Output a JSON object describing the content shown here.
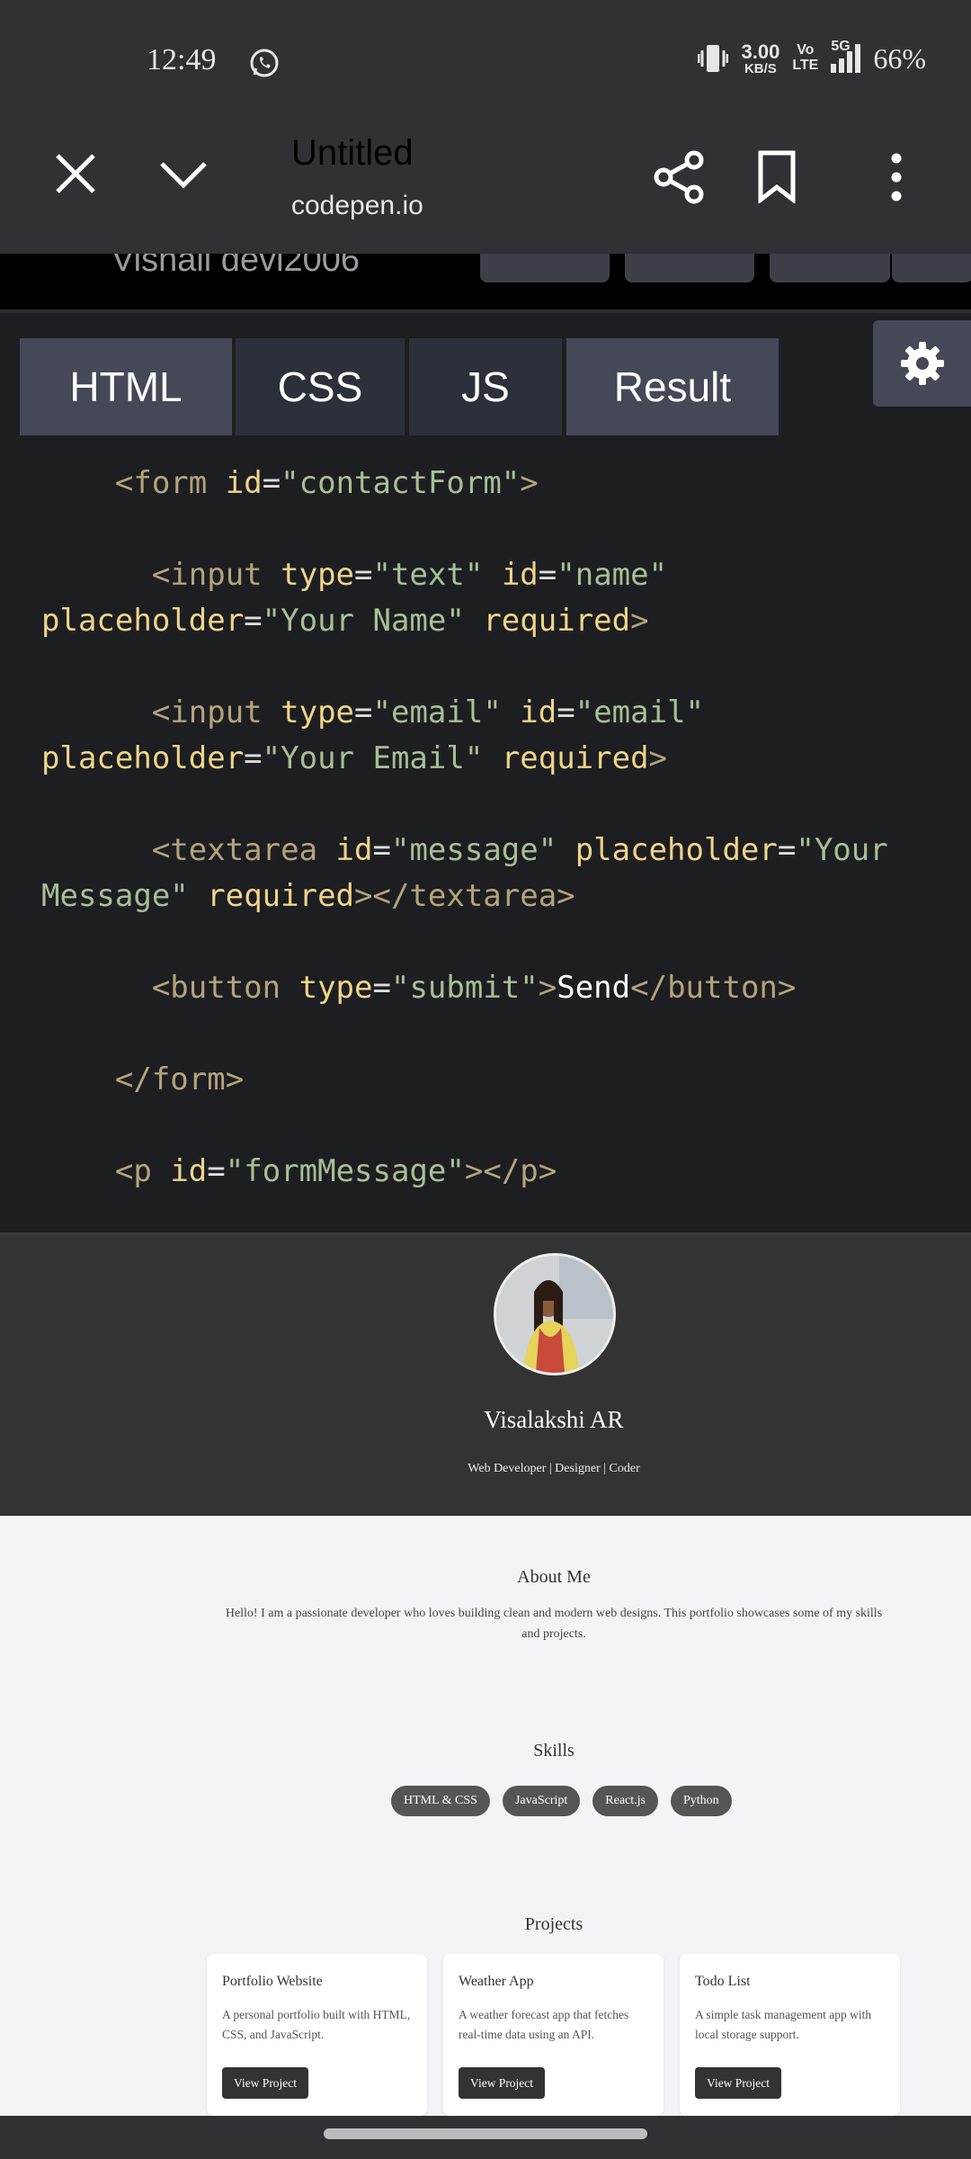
{
  "status_bar": {
    "time": "12:49",
    "net_speed": "3.00",
    "net_unit": "KB/S",
    "volte_top": "Vo",
    "volte_bottom": "LTE",
    "network": "5G",
    "battery": "66%"
  },
  "app_bar": {
    "title": "Untitled",
    "url": "codepen.io"
  },
  "pen_header": {
    "author_partial": "Vishali devi2006"
  },
  "editor": {
    "tabs": [
      "HTML",
      "CSS",
      "JS",
      "Result"
    ]
  },
  "result": {
    "name": "Visalakshi AR",
    "tagline": "Web Developer | Designer | Coder",
    "about": {
      "title": "About Me",
      "text": "Hello! I am a passionate developer who loves building clean and modern web designs. This portfolio showcases some of my skills and projects."
    },
    "skills": {
      "title": "Skills",
      "items": [
        "HTML & CSS",
        "JavaScript",
        "React.js",
        "Python"
      ]
    },
    "projects": {
      "title": "Projects",
      "items": [
        {
          "title": "Portfolio Website",
          "desc": "A personal portfolio built with HTML, CSS, and JavaScript.",
          "button": "View Project"
        },
        {
          "title": "Weather App",
          "desc": "A weather forecast app that fetches real-time data using an API.",
          "button": "View Project"
        },
        {
          "title": "Todo List",
          "desc": "A simple task management app with local storage support.",
          "button": "View Project"
        }
      ]
    }
  },
  "icons": {
    "whatsapp": "whatsapp-icon",
    "close": "close-icon",
    "collapse": "chevron-down-icon",
    "share": "share-icon",
    "bookmark": "bookmark-icon",
    "more": "more-vert-icon",
    "settings": "gear-icon"
  },
  "colors": {
    "app_bar": "#303135",
    "editor_bg": "#1d1e22",
    "tab_active": "#444857",
    "tag": "#b5a47a",
    "attribute": "#f0d48a",
    "string": "#a9bf94"
  }
}
